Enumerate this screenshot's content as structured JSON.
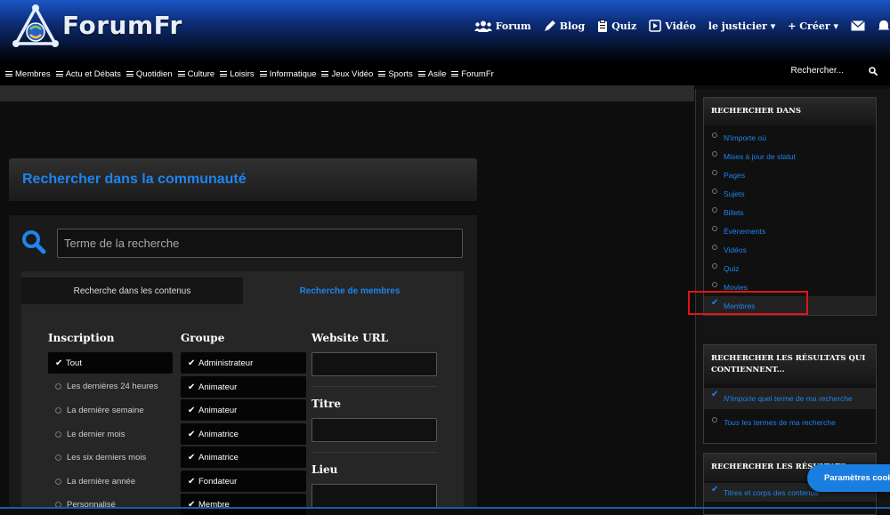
{
  "header": {
    "logo_text": "ForumFr",
    "nav": [
      {
        "label": "Forum",
        "icon": "users-icon"
      },
      {
        "label": "Blog",
        "icon": "pen-icon"
      },
      {
        "label": "Quiz",
        "icon": "clipboard-icon"
      },
      {
        "label": "Vidéo",
        "icon": "play-icon"
      },
      {
        "label": "le justicier ▾",
        "icon": ""
      },
      {
        "label": "+ Créer ▾",
        "icon": ""
      }
    ]
  },
  "menubar": {
    "items": [
      "Membres",
      "Actu et Débats",
      "Quotidien",
      "Culture",
      "Loisirs",
      "Informatique",
      "Jeux Vidéo",
      "Sports",
      "Asile",
      "ForumFr"
    ],
    "search_placeholder": "Rechercher..."
  },
  "main": {
    "title": "Rechercher dans la communauté",
    "search_placeholder": "Terme de la recherche",
    "tabs": [
      "Recherche dans les contenus",
      "Recherche de membres"
    ],
    "inscription": {
      "heading": "Inscription",
      "options": [
        "Tout",
        "Les dernières 24 heures",
        "La dernière semaine",
        "Le dernier mois",
        "Les six derniers mois",
        "La dernière année",
        "Personnalisé"
      ]
    },
    "groupe": {
      "heading": "Groupe",
      "options": [
        "Administrateur",
        "Animateur",
        "Animateur",
        "Animatrice",
        "Animatrice",
        "Fondateur",
        "Membre"
      ]
    },
    "fields": [
      "Website URL",
      "Titre",
      "Lieu"
    ]
  },
  "sidebar": {
    "panel1": {
      "heading": "RECHERCHER DANS",
      "options": [
        "N'importe où",
        "Mises à jour de statut",
        "Pages",
        "Sujets",
        "Billets",
        "Évènements",
        "Vidéos",
        "Quiz",
        "Movies",
        "Membres"
      ]
    },
    "panel2": {
      "heading": "RECHERCHER LES RÉSULTATS QUI CONTIENNENT...",
      "opt1_em": "N'importe",
      "opt1_rest": " quel terme de ma recherche",
      "opt2_em": "Tous",
      "opt2_rest": " les termes de ma recherche"
    },
    "panel3": {
      "heading": "RECHERCHER LES RÉSULTATS",
      "option": "Titres et corps des contenus"
    }
  },
  "cookie_button": "Paramètres cookies",
  "colors": {
    "accent": "#1e84ee",
    "highlight_border": "#e01515",
    "cookie_button": "#1a7de0"
  }
}
